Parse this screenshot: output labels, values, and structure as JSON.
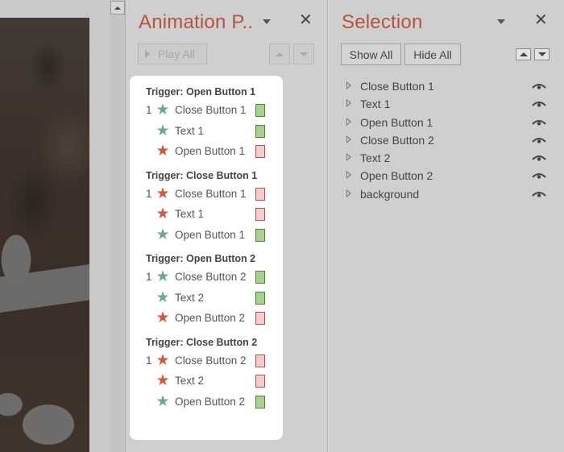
{
  "colors": {
    "pane_title": "#b5533c",
    "entrance_star": "#6aa895",
    "exit_star": "#d05a3a",
    "entrance_bar_fill": "#a9d18e",
    "entrance_bar_border": "#538135",
    "exit_bar_fill": "#f8cbcb",
    "exit_bar_border": "#b05050"
  },
  "slide_scroll": {
    "up_icon": "scroll-up-icon"
  },
  "animation_pane": {
    "title": "Animation P..",
    "close_glyph": "✕",
    "play_all_label": "Play All",
    "move_up_icon": "move-up-icon",
    "move_down_icon": "move-down-icon",
    "groups": [
      {
        "trigger": "Trigger: Open Button 1",
        "items": [
          {
            "num": "1",
            "effect": "entrance",
            "label": "Close Button 1"
          },
          {
            "num": "",
            "effect": "entrance",
            "label": "Text 1"
          },
          {
            "num": "",
            "effect": "exit",
            "label": "Open Button 1"
          }
        ]
      },
      {
        "trigger": "Trigger: Close Button 1",
        "items": [
          {
            "num": "1",
            "effect": "exit",
            "label": "Close Button 1"
          },
          {
            "num": "",
            "effect": "exit",
            "label": "Text 1"
          },
          {
            "num": "",
            "effect": "entrance",
            "label": "Open Button 1"
          }
        ]
      },
      {
        "trigger": "Trigger: Open Button 2",
        "items": [
          {
            "num": "1",
            "effect": "entrance",
            "label": "Close Button 2"
          },
          {
            "num": "",
            "effect": "entrance",
            "label": "Text 2"
          },
          {
            "num": "",
            "effect": "exit",
            "label": "Open Button 2"
          }
        ]
      },
      {
        "trigger": "Trigger: Close Button 2",
        "items": [
          {
            "num": "1",
            "effect": "exit",
            "label": "Close Button 2"
          },
          {
            "num": "",
            "effect": "exit",
            "label": "Text 2"
          },
          {
            "num": "",
            "effect": "entrance",
            "label": "Open Button 2"
          }
        ]
      }
    ]
  },
  "selection_pane": {
    "title": "Selection",
    "close_glyph": "✕",
    "show_all_label": "Show All",
    "hide_all_label": "Hide All",
    "items": [
      {
        "label": "Close Button 1",
        "visible": true
      },
      {
        "label": "Text 1",
        "visible": true
      },
      {
        "label": "Open Button 1",
        "visible": true
      },
      {
        "label": "Close Button 2",
        "visible": true
      },
      {
        "label": "Text 2",
        "visible": true
      },
      {
        "label": "Open Button 2",
        "visible": true
      },
      {
        "label": "background",
        "visible": true
      }
    ]
  },
  "star_glyph": "★"
}
